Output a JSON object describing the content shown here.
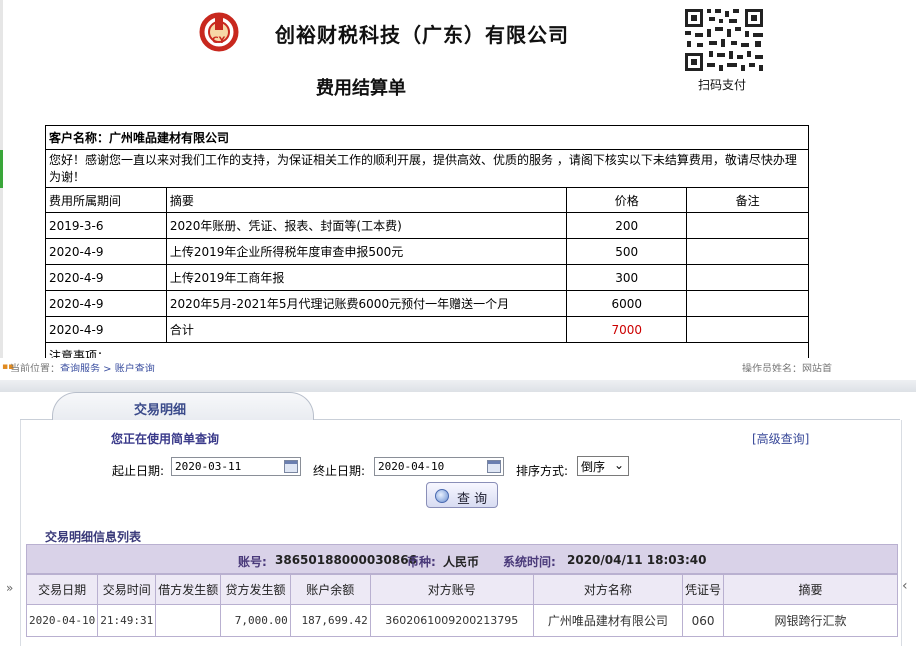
{
  "invoice": {
    "company_name": "创裕财税科技（广东）有限公司",
    "doc_title": "费用结算单",
    "qr_caption": "扫码支付",
    "customer_label": "客户名称：",
    "customer_name": "广州唯品建材有限公司",
    "greeting": "您好！感谢您一直以来对我们工作的支持，为保证相关工作的顺利开展，提供高效、优质的服务 ，请阁下核实以下未结算费用，敬请尽快办理为谢！",
    "columns": [
      "费用所属期间",
      "摘要",
      "价格",
      "备注"
    ],
    "rows": [
      {
        "period": "2019-3-6",
        "summary": "2020年账册、凭证、报表、封面等(工本费)",
        "price": "200",
        "note": ""
      },
      {
        "period": "2020-4-9",
        "summary": "上传2019年企业所得税年度审查申报500元",
        "price": "500",
        "note": ""
      },
      {
        "period": "2020-4-9",
        "summary": "上传2019年工商年报",
        "price": "300",
        "note": ""
      },
      {
        "period": "2020-4-9",
        "summary": "2020年5月-2021年5月代理记账费6000元预付一年赠送一个月",
        "price": "6000",
        "note": ""
      },
      {
        "period": "2020-4-9",
        "summary": "合计",
        "price": "7000",
        "note": ""
      }
    ],
    "notes_label": "注意事项：",
    "total_color": "#cc0000"
  },
  "peek": {
    "location_prefix": "当前位置：",
    "location_links": "查询服务 > 账户查询",
    "right_text": "操作员姓名：网站首"
  },
  "bank": {
    "tab_label": "交易明细",
    "query_heading": "您正在使用简单查询",
    "advanced_link": "[高级查询]",
    "start_label": "起止日期:",
    "start_value": "2020-03-11",
    "end_label": "终止日期:",
    "end_value": "2020-04-10",
    "sort_label": "排序方式:",
    "sort_value": "倒序",
    "search_button": "查 询",
    "list_heading": "交易明细信息列表",
    "account_label": "账号:",
    "account_value": "38650188000030866",
    "currency_label": "币种:",
    "currency_value": "人民币",
    "systime_label": "系统时间:",
    "systime_value": "2020/04/11 18:03:40",
    "columns": [
      "交易日期",
      "交易时间",
      "借方发生额",
      "贷方发生额",
      "账户余额",
      "对方账号",
      "对方名称",
      "凭证号",
      "摘要"
    ],
    "rows": [
      {
        "date": "2020-04-10",
        "time": "21:49:31",
        "debit": "",
        "credit": "7,000.00",
        "balance": "187,699.42",
        "counter_account": "3602061009200213795",
        "counter_name": "广州唯品建材有限公司",
        "voucher": "060",
        "memo": "网银跨行汇款"
      }
    ],
    "side_left": "»",
    "side_right": "‹"
  }
}
